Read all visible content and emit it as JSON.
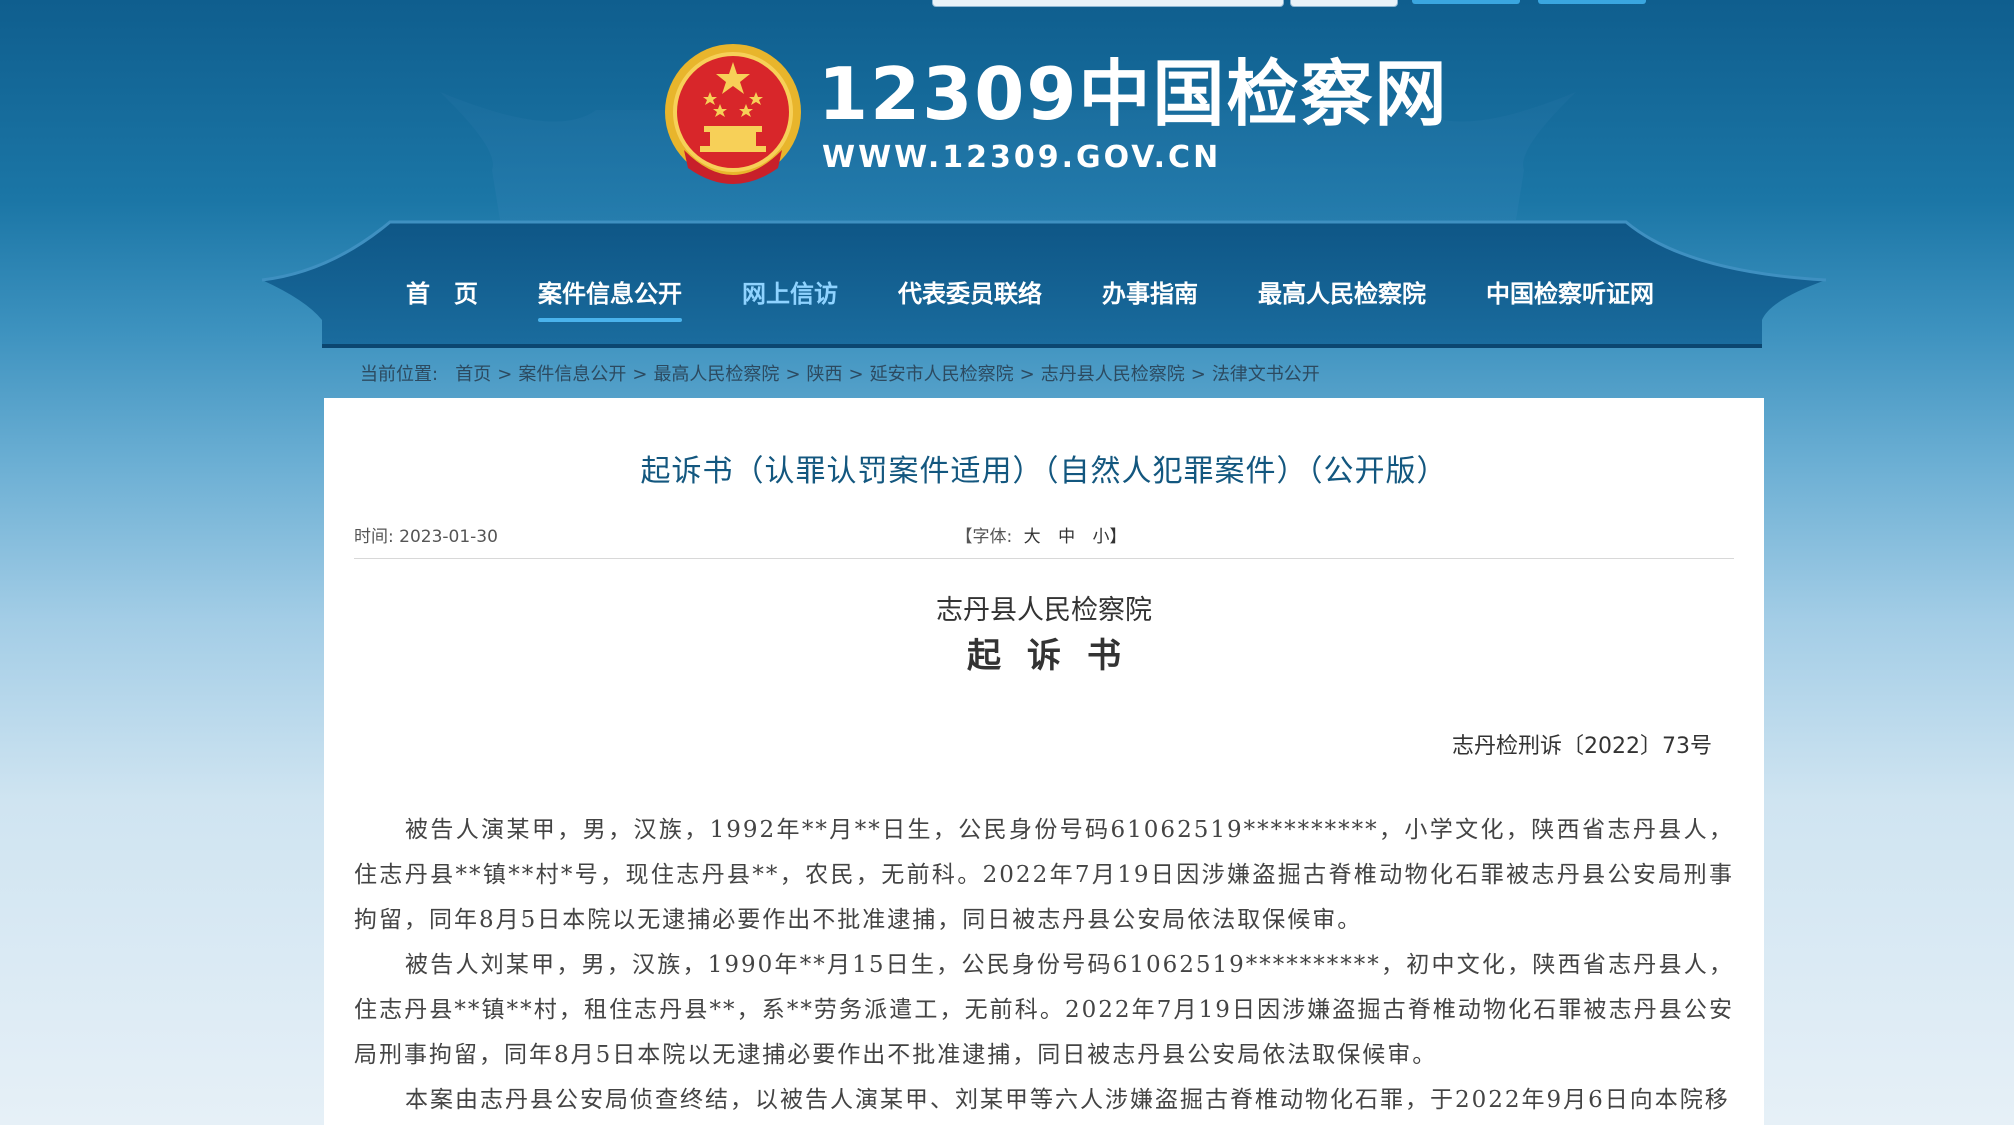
{
  "colors": {
    "nav_active": "#4ab3ec",
    "title_blue": "#13577f",
    "header_dark": "#0d4f7a"
  },
  "header": {
    "emblem": "national-emblem-icon",
    "site_title": "12309中国检察网",
    "site_url": "WWW.12309.GOV.CN"
  },
  "nav": {
    "items": [
      {
        "label": "首　页"
      },
      {
        "label": "案件信息公开"
      },
      {
        "label": "网上信访"
      },
      {
        "label": "代表委员联络"
      },
      {
        "label": "办事指南"
      },
      {
        "label": "最高人民检察院"
      },
      {
        "label": "中国检察听证网"
      }
    ],
    "active_index": 1
  },
  "breadcrumb": {
    "prefix": "当前位置:",
    "items": [
      "首页",
      "案件信息公开",
      "最高人民检察院",
      "陕西",
      "延安市人民检察院",
      "志丹县人民检察院",
      "法律文书公开"
    ],
    "separator": ">"
  },
  "article": {
    "title": "起诉书（认罪认罚案件适用）（自然人犯罪案件）（公开版）",
    "time_label": "时间:",
    "time_value": "2023-01-30",
    "font_size": {
      "open": "【字体:",
      "large": "大",
      "medium": "中",
      "small": "小】"
    },
    "court_name": "志丹县人民检察院",
    "doc_title": "起诉书",
    "doc_number": "志丹检刑诉〔2022〕73号",
    "paragraphs": [
      "被告人演某甲，男，汉族，1992年**月**日生，公民身份号码61062519**********，小学文化，陕西省志丹县人，住志丹县**镇**村*号，现住志丹县**，农民，无前科。2022年7月19日因涉嫌盗掘古脊椎动物化石罪被志丹县公安局刑事拘留，同年8月5日本院以无逮捕必要作出不批准逮捕，同日被志丹县公安局依法取保候审。",
      "被告人刘某甲，男，汉族，1990年**月15日生，公民身份号码61062519**********，初中文化，陕西省志丹县人，住志丹县**镇**村，租住志丹县**，系**劳务派遣工，无前科。2022年7月19日因涉嫌盗掘古脊椎动物化石罪被志丹县公安局刑事拘留，同年8月5日本院以无逮捕必要作出不批准逮捕，同日被志丹县公安局依法取保候审。",
      "本案由志丹县公安局侦查终结，以被告人演某甲、刘某甲等六人涉嫌盗掘古脊椎动物化石罪，于2022年9月6日向本院移"
    ]
  }
}
